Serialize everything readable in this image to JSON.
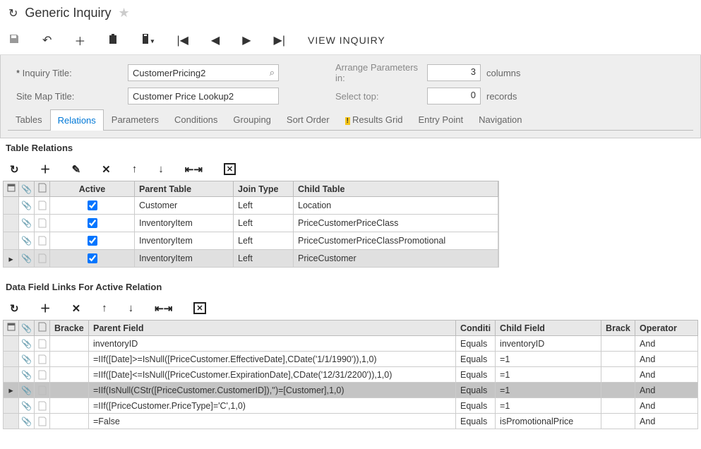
{
  "header": {
    "title": "Generic Inquiry"
  },
  "toolbar": {
    "view_inquiry": "VIEW INQUIRY"
  },
  "form": {
    "inquiry_title_label": "Inquiry Title:",
    "inquiry_title_value": "CustomerPricing2",
    "site_map_title_label": "Site Map Title:",
    "site_map_title_value": "Customer Price Lookup2",
    "arrange_label": "Arrange Parameters in:",
    "arrange_value": "3",
    "arrange_suffix": "columns",
    "select_top_label": "Select top:",
    "select_top_value": "0",
    "select_top_suffix": "records"
  },
  "tabs": [
    {
      "label": "Tables"
    },
    {
      "label": "Relations"
    },
    {
      "label": "Parameters"
    },
    {
      "label": "Conditions"
    },
    {
      "label": "Grouping"
    },
    {
      "label": "Sort Order"
    },
    {
      "label": "Results Grid",
      "warning": true
    },
    {
      "label": "Entry Point"
    },
    {
      "label": "Navigation"
    }
  ],
  "relations": {
    "title": "Table Relations",
    "columns": {
      "active": "Active",
      "parent_table": "Parent Table",
      "join_type": "Join Type",
      "child_table": "Child Table"
    },
    "rows": [
      {
        "active": true,
        "parent": "Customer",
        "join": "Left",
        "child": "Location"
      },
      {
        "active": true,
        "parent": "InventoryItem",
        "join": "Left",
        "child": "PriceCustomerPriceClass"
      },
      {
        "active": true,
        "parent": "InventoryItem",
        "join": "Left",
        "child": "PriceCustomerPriceClassPromotional"
      },
      {
        "active": true,
        "parent": "InventoryItem",
        "join": "Left",
        "child": "PriceCustomer"
      }
    ]
  },
  "links": {
    "title": "Data Field Links For Active Relation",
    "columns": {
      "brackets": "Bracke",
      "parent_field": "Parent Field",
      "condition": "Conditi",
      "child_field": "Child Field",
      "brackets2": "Brack",
      "operator": "Operator"
    },
    "rows": [
      {
        "parent": "inventoryID",
        "cond": "Equals",
        "child": "inventoryID",
        "op": "And"
      },
      {
        "parent": "=IIf([Date]>=IsNull([PriceCustomer.EffectiveDate],CDate('1/1/1990')),1,0)",
        "cond": "Equals",
        "child": "=1",
        "op": "And"
      },
      {
        "parent": "=IIf([Date]<=IsNull([PriceCustomer.ExpirationDate],CDate('12/31/2200')),1,0)",
        "cond": "Equals",
        "child": "=1",
        "op": "And"
      },
      {
        "parent": "=IIf(IsNull(CStr([PriceCustomer.CustomerID]),'')=[Customer],1,0)",
        "cond": "Equals",
        "child": "=1",
        "op": "And"
      },
      {
        "parent": "=IIf([PriceCustomer.PriceType]='C',1,0)",
        "cond": "Equals",
        "child": "=1",
        "op": "And"
      },
      {
        "parent": "=False",
        "cond": "Equals",
        "child": "isPromotionalPrice",
        "op": "And"
      }
    ]
  }
}
